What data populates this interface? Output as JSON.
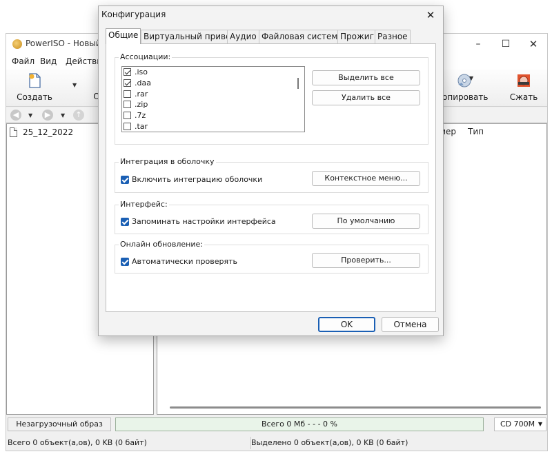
{
  "main_window": {
    "title": "PowerISO - Новый ф",
    "controls": {
      "minimize": "–",
      "maximize": "☐",
      "close": "✕"
    },
    "menu": [
      "Файл",
      "Вид",
      "Действие"
    ],
    "toolbar": {
      "create": "Создать",
      "open_partial": "О",
      "copy_partial": "опировать",
      "compress": "Сжать"
    },
    "tree_items": [
      "25_12_2022"
    ],
    "columns": [
      "мер",
      "Тип"
    ],
    "status": {
      "image_type": "Незагрузочный образ",
      "progress_text": "Всего 0 Мб   - - - 0 %",
      "progress_fraction": 0,
      "media": "CD 700M",
      "total": "Всего 0 объект(а,ов), 0 KB (0 байт)",
      "selected": "Выделено 0 объект(а,ов), 0 KB (0 байт)"
    }
  },
  "dialog": {
    "title": "Конфигурация",
    "close_glyph": "✕",
    "tabs": [
      "Общие",
      "Виртуальный привод",
      "Аудио",
      "Файловая система",
      "Прожиг",
      "Разное"
    ],
    "active_tab": 0,
    "associations": {
      "title": "Ассоциации:",
      "items": [
        {
          "ext": ".iso",
          "checked": true
        },
        {
          "ext": ".daa",
          "checked": true
        },
        {
          "ext": ".rar",
          "checked": false
        },
        {
          "ext": ".zip",
          "checked": false
        },
        {
          "ext": ".7z",
          "checked": false
        },
        {
          "ext": ".tar",
          "checked": false
        }
      ],
      "select_all": "Выделить все",
      "remove_all": "Удалить все"
    },
    "shell": {
      "title": "Интеграция в оболочку",
      "checkbox": "Включить интеграцию оболочки",
      "checked": true,
      "button": "Контекстное меню..."
    },
    "interface": {
      "title": "Интерфейс:",
      "checkbox": "Запоминать настройки интерфейса",
      "checked": true,
      "button": "По умолчанию"
    },
    "online": {
      "title": "Онлайн обновление:",
      "checkbox": "Автоматически проверять",
      "checked": true,
      "button": "Проверить..."
    },
    "ok": "OK",
    "cancel": "Отмена"
  }
}
